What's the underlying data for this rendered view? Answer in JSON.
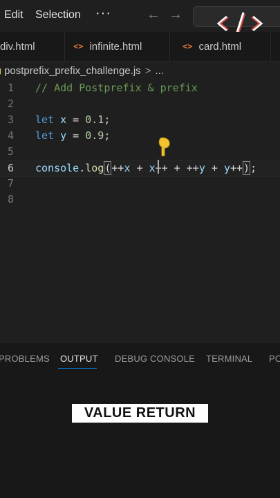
{
  "menu": {
    "edit": "Edit",
    "selection": "Selection",
    "more": "···"
  },
  "nav": {
    "back_icon": "arrow-left-icon",
    "forward_icon": "arrow-right-icon"
  },
  "tabs": [
    {
      "label": "div.html",
      "icon": "<>"
    },
    {
      "label": "infinite.html",
      "icon": "<>"
    },
    {
      "label": "card.html",
      "icon": "<>"
    }
  ],
  "breadcrumb": {
    "file": "postprefix_prefix_challenge.js",
    "separator": ">",
    "more": "..."
  },
  "editor": {
    "active_line": 6,
    "lines": [
      {
        "number": "1",
        "tokens": [
          {
            "t": "// Add Postprefix & prefix",
            "c": "comment"
          }
        ]
      },
      {
        "number": "2",
        "tokens": []
      },
      {
        "number": "3",
        "tokens": [
          {
            "t": "let",
            "c": "keyword"
          },
          {
            "t": " ",
            "c": "op"
          },
          {
            "t": "x",
            "c": "var"
          },
          {
            "t": " = ",
            "c": "op"
          },
          {
            "t": "0.1",
            "c": "num"
          },
          {
            "t": ";",
            "c": "op"
          }
        ]
      },
      {
        "number": "4",
        "tokens": [
          {
            "t": "let",
            "c": "keyword"
          },
          {
            "t": " ",
            "c": "op"
          },
          {
            "t": "y",
            "c": "var"
          },
          {
            "t": " = ",
            "c": "op"
          },
          {
            "t": "0.9",
            "c": "num"
          },
          {
            "t": ";",
            "c": "op"
          }
        ]
      },
      {
        "number": "5",
        "tokens": []
      },
      {
        "number": "6",
        "tokens": [
          {
            "t": "console",
            "c": "obj"
          },
          {
            "t": ".",
            "c": "op"
          },
          {
            "t": "log",
            "c": "fn"
          },
          {
            "t": "(",
            "c": "op-hl"
          },
          {
            "t": "++",
            "c": "op"
          },
          {
            "t": "x",
            "c": "var"
          },
          {
            "t": " + ",
            "c": "op"
          },
          {
            "t": "x",
            "c": "var"
          },
          {
            "t": "++ + ++",
            "c": "op"
          },
          {
            "t": "y",
            "c": "var"
          },
          {
            "t": " + ",
            "c": "op"
          },
          {
            "t": "y",
            "c": "var"
          },
          {
            "t": "++",
            "c": "op"
          },
          {
            "t": ")",
            "c": "op-hl"
          },
          {
            "t": ";",
            "c": "op"
          }
        ]
      },
      {
        "number": "7",
        "tokens": []
      },
      {
        "number": "8",
        "tokens": []
      }
    ]
  },
  "panel": {
    "tabs": [
      "PROBLEMS",
      "OUTPUT",
      "DEBUG CONSOLE",
      "TERMINAL",
      "PORTS"
    ],
    "active_tab": "OUTPUT"
  },
  "caption": "VALUE RETURN",
  "colors": {
    "accent": "#0078d4",
    "tab_icon": "#e37933",
    "logo_red": "#d9534f"
  }
}
